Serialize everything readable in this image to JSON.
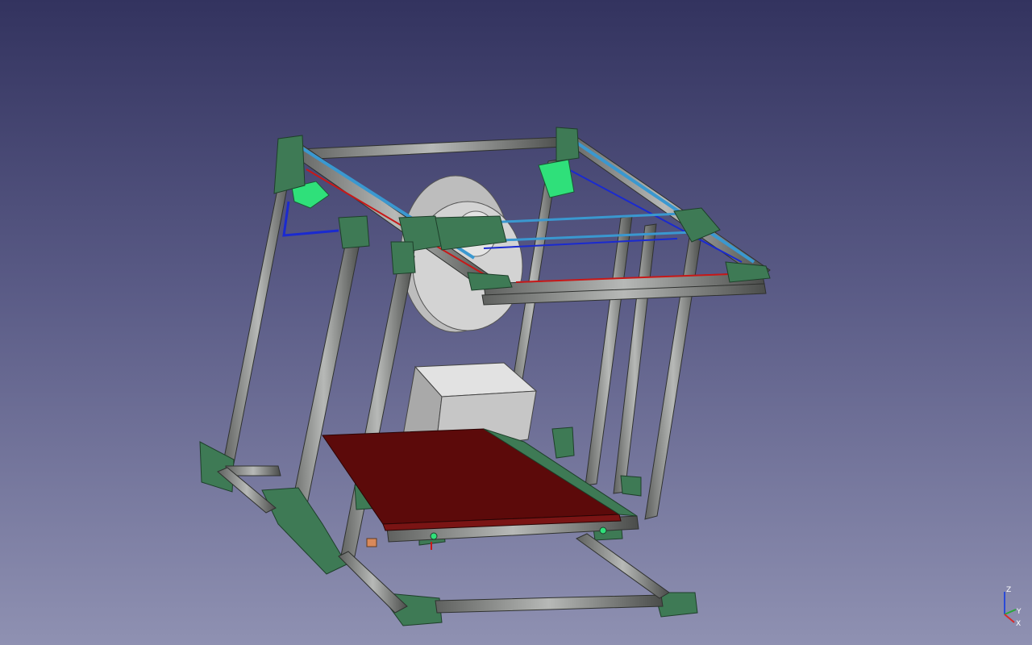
{
  "viewport": {
    "background_top": "#33335f",
    "background_bottom": "#8f91b2"
  },
  "model": {
    "frame_extrusion_color": "#8a8c8a",
    "printed_part_color": "#3e7a55",
    "highlight_part_color": "#2fe07a",
    "linear_rod_color": "#3a98d0",
    "belt_red_color": "#c81818",
    "belt_blue_color": "#1a2ad0",
    "heated_bed_color": "#5c0a0a",
    "spool_color": "#d0d0d0",
    "psu_box_color": "#c4c4c4"
  },
  "axis_cross": {
    "z_label": "Z",
    "y_label": "Y",
    "x_label": "X",
    "z_color": "#2a4ad8",
    "y_color": "#2aa838",
    "x_color": "#d82a2a"
  }
}
